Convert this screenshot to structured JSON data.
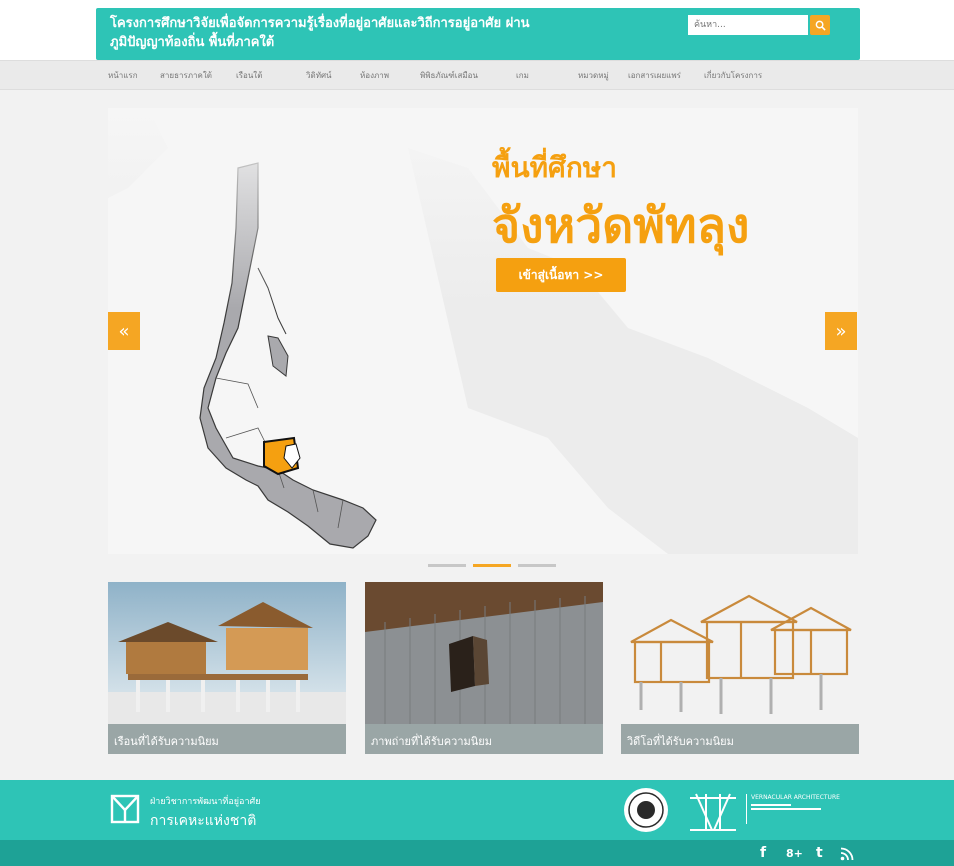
{
  "header": {
    "title": "โครงการศึกษาวิจัยเพื่อจัดการความรู้เรื่องที่อยู่อาศัยและวิถีการอยู่อาศัย ผ่านภูมิปัญญาท้องถิ่น พื้นที่ภาคใต้",
    "search_placeholder": "ค้นหา...",
    "search_icon": "search-icon"
  },
  "nav": {
    "items": [
      {
        "label": "หน้าแรก"
      },
      {
        "label": "สายธารภาคใต้"
      },
      {
        "label": "เรือนใต้"
      },
      {
        "label": "วิดิทัศน์"
      },
      {
        "label": "ห้องภาพ"
      },
      {
        "label": "พิพิธภัณฑ์เสมือน"
      },
      {
        "label": "เกม"
      },
      {
        "label": "หมวดหมู่"
      },
      {
        "label": "เอกสารเผยแพร่"
      },
      {
        "label": "เกี่ยวกับโครงการ"
      }
    ]
  },
  "slider": {
    "subtitle": "พื้นที่ศึกษา",
    "title": "จังหวัดพัทลุง",
    "cta_label": "เข้าสู่เนื้อหา >>",
    "prev_label": "«",
    "next_label": "»",
    "active_slide": 2,
    "slide_count": 3
  },
  "cards": [
    {
      "caption": "เรือนที่ได้รับความนิยม"
    },
    {
      "caption": "ภาพถ่ายที่ได้รับความนิยม"
    },
    {
      "caption": "วิดีโอที่ได้รับความนิยม"
    }
  ],
  "footer": {
    "dept_name": "ฝ่ายวิชาการพัฒนาที่อยู่อาศัย",
    "org_name": "การเคหะแห่งชาติ",
    "partner_logo_text": "VERNACULAR ARCHITECTURE",
    "social": [
      {
        "icon": "facebook-icon",
        "glyph": "f"
      },
      {
        "icon": "google-plus-icon",
        "glyph": "8+"
      },
      {
        "icon": "tumblr-icon",
        "glyph": "t"
      },
      {
        "icon": "rss-icon",
        "glyph": "rss"
      }
    ]
  },
  "colors": {
    "teal": "#2ec4b6",
    "teal_dark": "#1ea296",
    "orange": "#f5a623",
    "caption_bg": "#9aa6a6"
  }
}
